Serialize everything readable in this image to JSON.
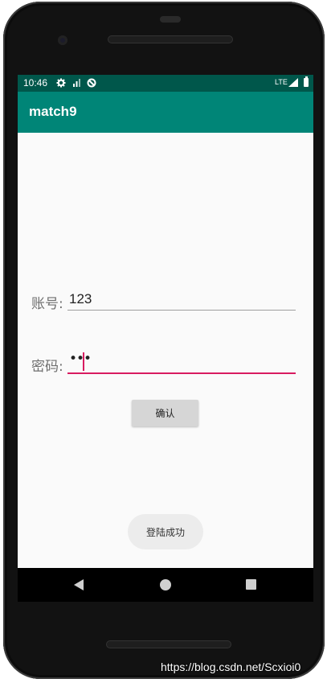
{
  "status_bar": {
    "time": "10:46",
    "network": "LTE",
    "icons": [
      "gear-icon",
      "signal-small-icon",
      "sync-icon",
      "lte-signal-icon",
      "battery-icon"
    ]
  },
  "app_bar": {
    "title": "match9"
  },
  "form": {
    "account_label": "账号:",
    "account_value": "123",
    "password_label": "密码:",
    "password_mask": "•••",
    "confirm_label": "确认"
  },
  "toast": {
    "message": "登陆成功"
  },
  "nav_bar": {
    "icons": [
      "back-icon",
      "home-icon",
      "recents-icon"
    ]
  },
  "watermark": "https://blog.csdn.net/Scxioi0",
  "colors": {
    "status_bar": "#00574b",
    "app_bar": "#008577",
    "accent": "#d81b60",
    "background": "#fafafa"
  }
}
